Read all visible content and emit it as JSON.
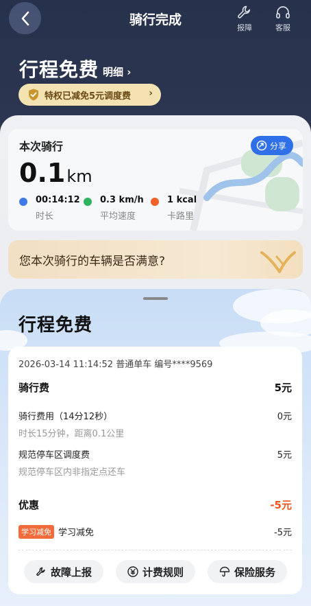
{
  "nav": {
    "title": "骑行完成",
    "report_label": "报障",
    "service_label": "客服"
  },
  "header": {
    "free_title": "行程免费",
    "detail_link": "明细 ›",
    "privilege_text": "特权已减免5元调度费",
    "privilege_arrow": "›"
  },
  "ride": {
    "label": "本次骑行",
    "share_label": "分享",
    "distance": "0.1",
    "distance_unit": "km",
    "stats": [
      {
        "value": "00:14:12",
        "label": "时长",
        "color": "#3f7be6"
      },
      {
        "value": "0.3 km/h",
        "label": "平均速度",
        "color": "#2fb35e"
      },
      {
        "value": "1 kcal",
        "label": "卡路里",
        "color": "#f0622a"
      }
    ],
    "satisfaction_question": "您本次骑行的车辆是否满意?"
  },
  "sheet": {
    "title": "行程免费",
    "meta": "2026-03-14 11:14:52 普通单车 编号****9569",
    "riding_fee": {
      "title": "骑行费",
      "total": "5元",
      "items": [
        {
          "name": "骑行费用（14分12秒）",
          "sub": "时长15分钟，距离0.1公里",
          "value": "0元"
        },
        {
          "name": "规范停车区调度费",
          "sub": "规范停车区内非指定点还车",
          "value": "5元"
        }
      ]
    },
    "discount": {
      "title": "优惠",
      "total": "-5元",
      "tag": "学习减免",
      "name": "学习减免",
      "value": "-5元"
    },
    "actions": {
      "report": "故障上报",
      "pricing": "计费规则",
      "insurance": "保险服务"
    }
  },
  "colors": {
    "accent_blue": "#2f6fe8",
    "discount_orange": "#f0531c",
    "privilege_gold": "#f3e2b2"
  }
}
